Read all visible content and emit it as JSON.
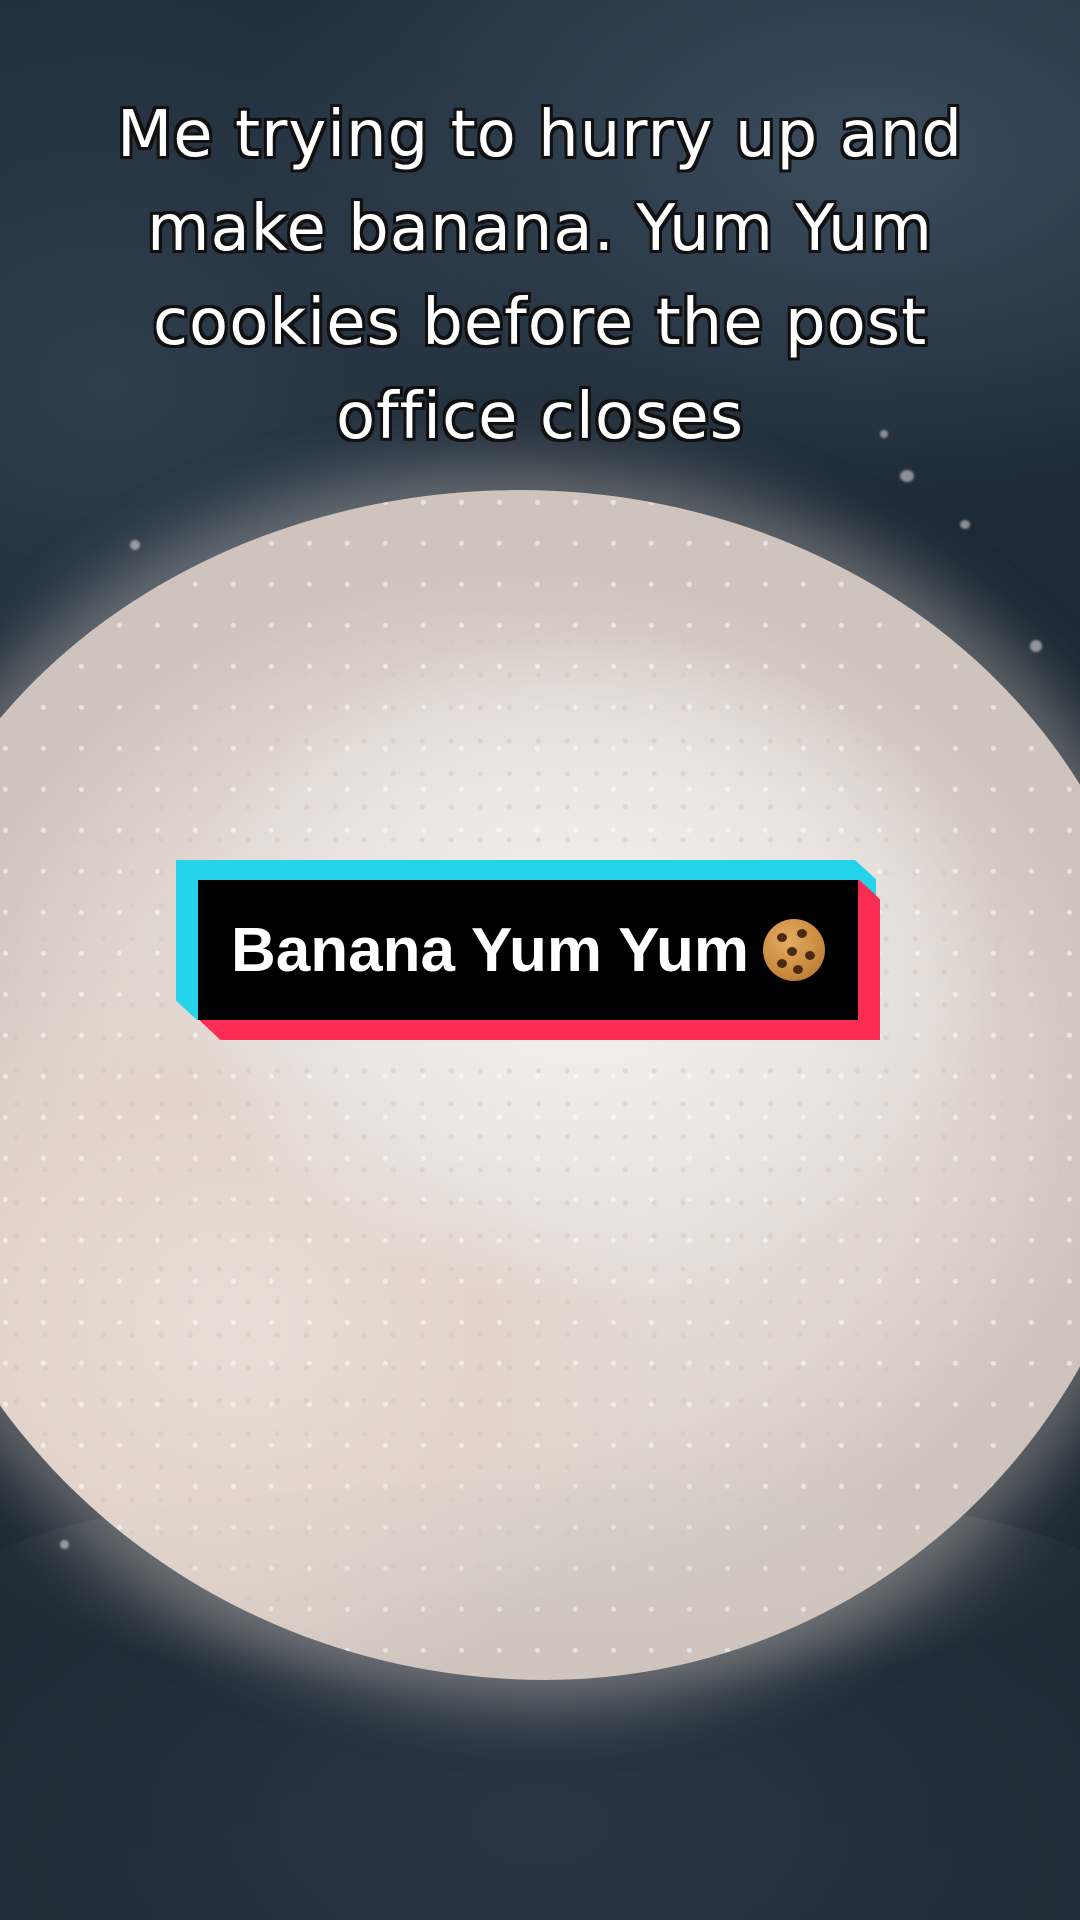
{
  "caption": {
    "line1": "Me trying to hurry up and",
    "line2": "make banana. Yum Yum",
    "line3": "cookies before the post",
    "line4": "office closes"
  },
  "title_card": {
    "text": "Banana Yum Yum",
    "icon": "cookie-icon",
    "colors": {
      "back_layer": "#25d4ea",
      "shadow_layer": "#fb2d55",
      "front_layer": "#000000",
      "text": "#ffffff"
    }
  }
}
